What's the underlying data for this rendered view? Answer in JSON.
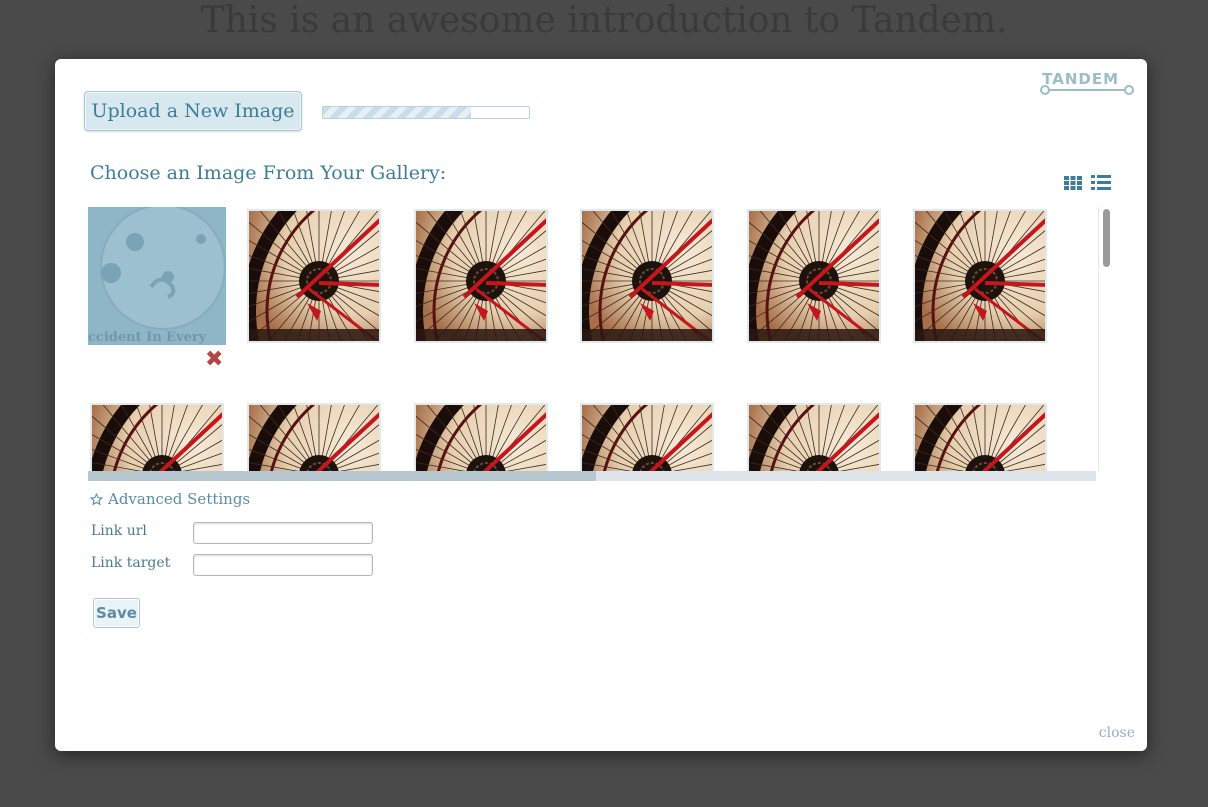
{
  "background": {
    "title": "This is an awesome introduction to Tandem."
  },
  "header": {
    "logo_text": "TANDEM",
    "upload_button_label": "Upload a New Image",
    "upload_progress": 0.72
  },
  "gallery": {
    "heading": "Choose an Image From Your Gallery:",
    "view_icons": [
      "grid-view-icon",
      "list-view-icon"
    ],
    "selected_image_text": "ccident In Every",
    "delete_icon": "close-x-icon",
    "rows": [
      [
        "selected-logo",
        "bike-wheel",
        "bike-wheel",
        "bike-wheel",
        "bike-wheel",
        "bike-wheel"
      ],
      [
        "bike-wheel",
        "bike-wheel",
        "bike-wheel",
        "bike-wheel",
        "bike-wheel",
        "bike-wheel"
      ]
    ]
  },
  "advanced": {
    "toggle_label": "Advanced Settings",
    "icon": "star-outline-icon",
    "link_url_label": "Link url",
    "link_url_value": "",
    "link_target_label": "Link target",
    "link_target_value": ""
  },
  "footer": {
    "save_label": "Save",
    "close_label": "close"
  },
  "colors": {
    "accent": "#3e7d9a",
    "delete": "#b24545",
    "overlay": "#4a4a4a"
  }
}
